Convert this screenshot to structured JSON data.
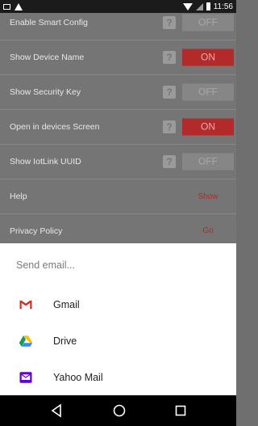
{
  "status_bar": {
    "time": "11:56"
  },
  "settings": {
    "rows": [
      {
        "label": "Enable Smart Config",
        "control": "OFF"
      },
      {
        "label": "Show Device Name",
        "control": "ON"
      },
      {
        "label": "Show Security Key",
        "control": "OFF"
      },
      {
        "label": "Open in devices Screen",
        "control": "ON"
      },
      {
        "label": "Show IotLink UUID",
        "control": "OFF"
      },
      {
        "label": "Help",
        "action": "Show"
      },
      {
        "label": "Privacy Policy",
        "action": "Go"
      }
    ]
  },
  "sheet": {
    "title": "Send email...",
    "apps": [
      {
        "label": "Gmail",
        "icon": "gmail-icon"
      },
      {
        "label": "Drive",
        "icon": "drive-icon"
      },
      {
        "label": "Yahoo Mail",
        "icon": "yahoo-mail-icon"
      }
    ]
  },
  "colors": {
    "accent_red": "#b22a2a",
    "dim_overlay": "#757575",
    "sheet_bg": "#ffffff",
    "nav_bg": "#000000"
  }
}
